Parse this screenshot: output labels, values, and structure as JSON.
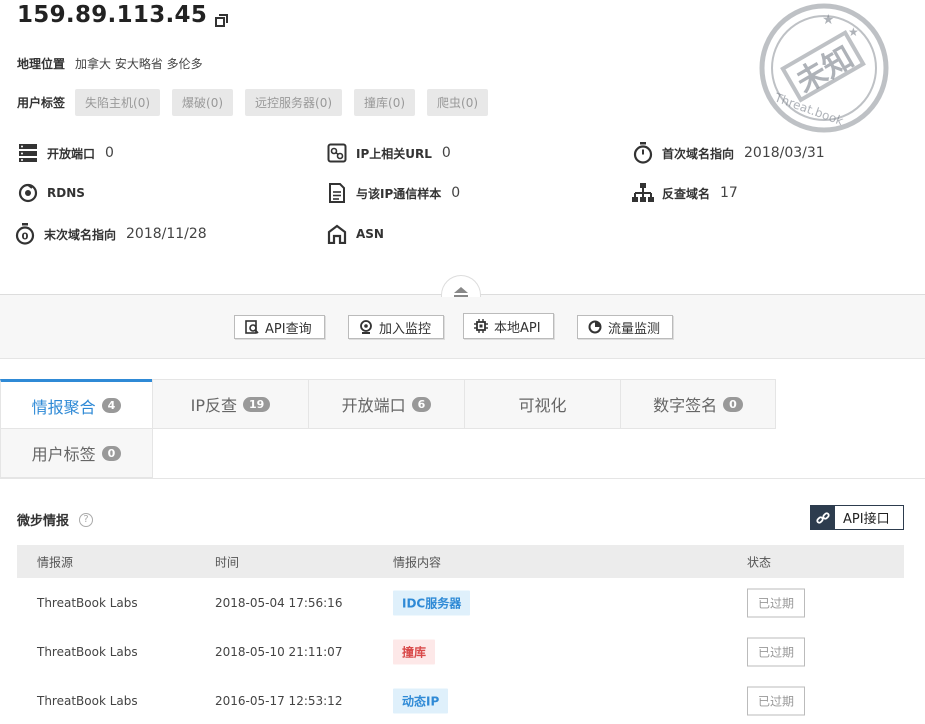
{
  "header": {
    "ip": "159.89.113.45",
    "geo_label": "地理位置",
    "geo_value": "加拿大 安大略省 多伦多",
    "tags_label": "用户标签",
    "tags": [
      "失陷主机(0)",
      "爆破(0)",
      "远控服务器(0)",
      "撞库(0)",
      "爬虫(0)"
    ],
    "stamp_text": "未知",
    "stamp_sub": "Threat.book"
  },
  "info": {
    "open_ports_label": "开放端口",
    "open_ports_value": "0",
    "ip_url_label": "IP上相关URL",
    "ip_url_value": "0",
    "first_domain_label": "首次域名指向",
    "first_domain_value": "2018/03/31",
    "rdns_label": "RDNS",
    "samples_label": "与该IP通信样本",
    "samples_value": "0",
    "reverse_domain_label": "反查域名",
    "reverse_domain_value": "17",
    "last_domain_label": "末次域名指向",
    "last_domain_value": "2018/11/28",
    "asn_label": "ASN"
  },
  "toolbar": {
    "api_query": "API查询",
    "add_monitor": "加入监控",
    "local_api": "本地API",
    "traffic_monitor": "流量监测"
  },
  "tabs": [
    {
      "label": "情报聚合",
      "count": "4"
    },
    {
      "label": "IP反查",
      "count": "19"
    },
    {
      "label": "开放端口",
      "count": "6"
    },
    {
      "label": "可视化",
      "count": ""
    },
    {
      "label": "数字签名",
      "count": "0"
    },
    {
      "label": "用户标签",
      "count": "0"
    }
  ],
  "intel": {
    "title": "微步情报",
    "api_button": "API接口",
    "columns": [
      "情报源",
      "时间",
      "情报内容",
      "状态"
    ],
    "rows": [
      {
        "source": "ThreatBook Labs",
        "time": "2018-05-04 17:56:16",
        "content": "IDC服务器",
        "status": "已过期"
      },
      {
        "source": "ThreatBook Labs",
        "time": "2018-05-10 21:11:07",
        "content": "撞库",
        "status": "已过期"
      },
      {
        "source": "ThreatBook Labs",
        "time": "2016-05-17 12:53:12",
        "content": "动态IP",
        "status": "已过期"
      }
    ]
  },
  "colors": {
    "accent": "#2f8ad6",
    "dark": "#2d3c4e",
    "tag_blue_bg": "#dff0fb",
    "tag_red_bg": "#fde8e8",
    "tag_red_text": "#d94a4a"
  }
}
